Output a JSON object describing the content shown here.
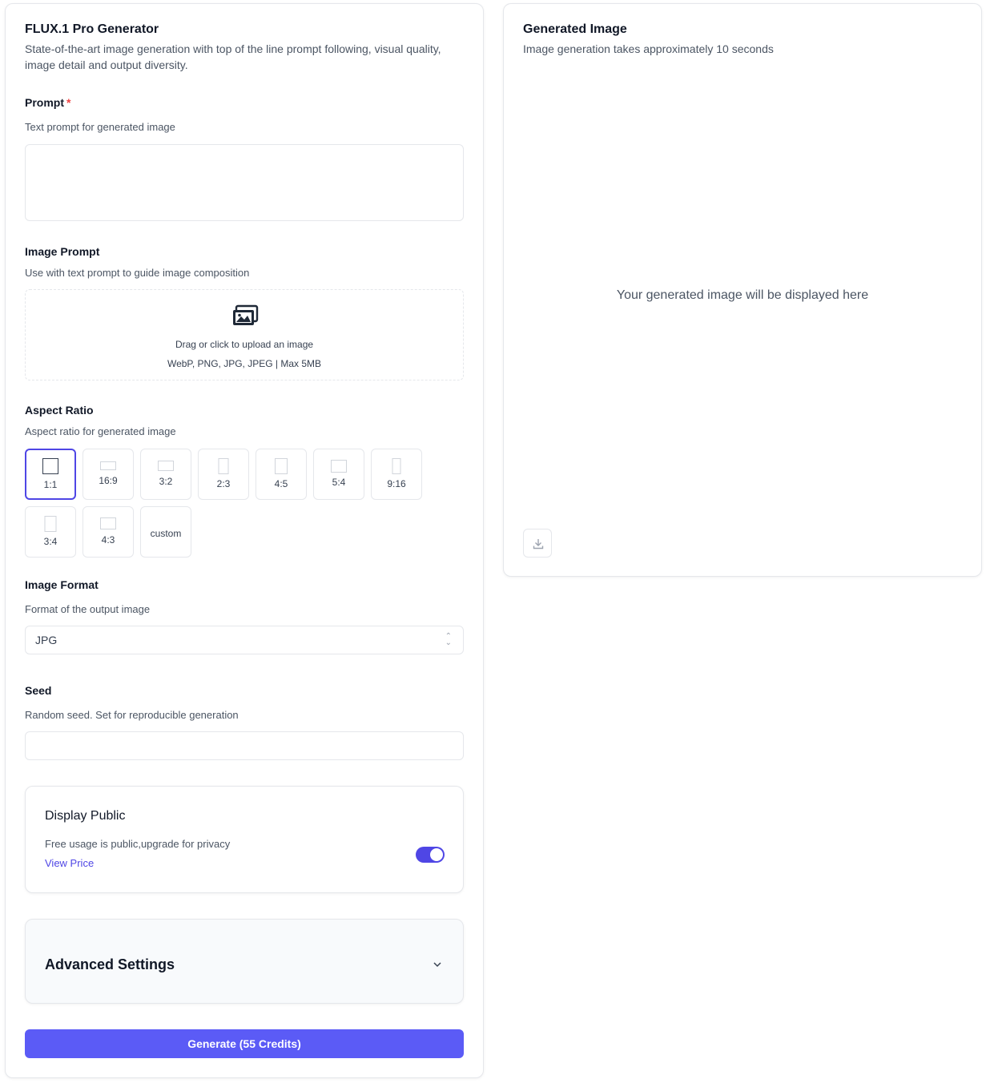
{
  "generator": {
    "title": "FLUX.1 Pro Generator",
    "description": "State-of-the-art image generation with top of the line prompt following, visual quality, image detail and output diversity."
  },
  "prompt": {
    "label": "Prompt",
    "required_mark": "*",
    "help": "Text prompt for generated image",
    "value": ""
  },
  "image_prompt": {
    "label": "Image Prompt",
    "help": "Use with text prompt to guide image composition",
    "upload_text": "Drag or click to upload an image",
    "formats_text": "WebP, PNG, JPG, JPEG | Max 5MB",
    "icon": "images-icon"
  },
  "aspect_ratio": {
    "label": "Aspect Ratio",
    "help": "Aspect ratio for generated image",
    "selected": "1:1",
    "options": [
      {
        "label": "1:1"
      },
      {
        "label": "16:9"
      },
      {
        "label": "3:2"
      },
      {
        "label": "2:3"
      },
      {
        "label": "4:5"
      },
      {
        "label": "5:4"
      },
      {
        "label": "9:16"
      },
      {
        "label": "3:4"
      },
      {
        "label": "4:3"
      },
      {
        "label": "custom"
      }
    ]
  },
  "image_format": {
    "label": "Image Format",
    "help": "Format of the output image",
    "value": "JPG"
  },
  "seed": {
    "label": "Seed",
    "help": "Random seed. Set for reproducible generation",
    "value": ""
  },
  "display_public": {
    "title": "Display Public",
    "description": "Free usage is public,upgrade for privacy",
    "link": "View Price",
    "enabled": true
  },
  "advanced": {
    "title": "Advanced Settings"
  },
  "generate_button": {
    "label": "Generate (55 Credits)"
  },
  "output": {
    "title": "Generated Image",
    "subtitle": "Image generation takes approximately 10 seconds",
    "placeholder": "Your generated image will be displayed here",
    "download_icon": "download-icon"
  },
  "colors": {
    "accent": "#5b5bf6",
    "toggle_on": "#4f46e5",
    "required": "#ef4444",
    "link": "#4f46e5",
    "border": "#e5e7eb"
  }
}
